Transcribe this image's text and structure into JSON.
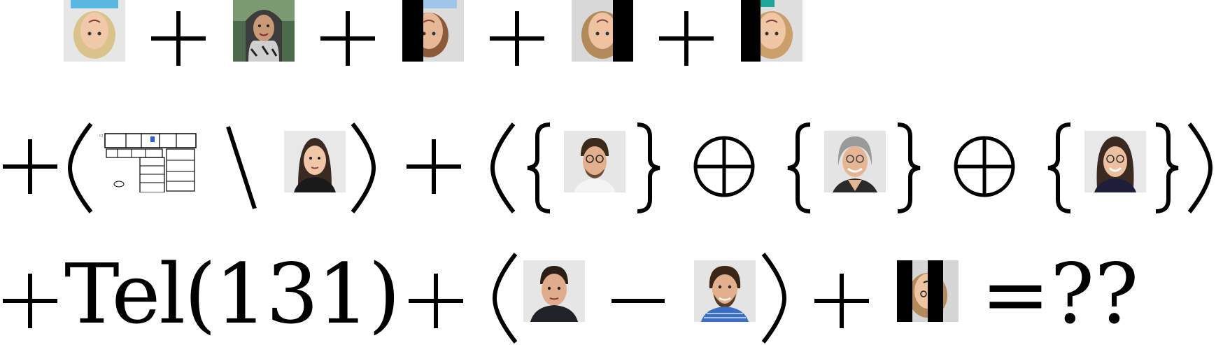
{
  "puzzle": {
    "row3": {
      "tel_text": "Tel(131)",
      "result_text": "=??"
    }
  },
  "colors": {
    "ink": "#000000",
    "photo_bg": "#e4e4e4",
    "blue_shirt": "#3a8fd6",
    "teal_shirt": "#1fa89a",
    "hijab": "#3c3c3c"
  }
}
